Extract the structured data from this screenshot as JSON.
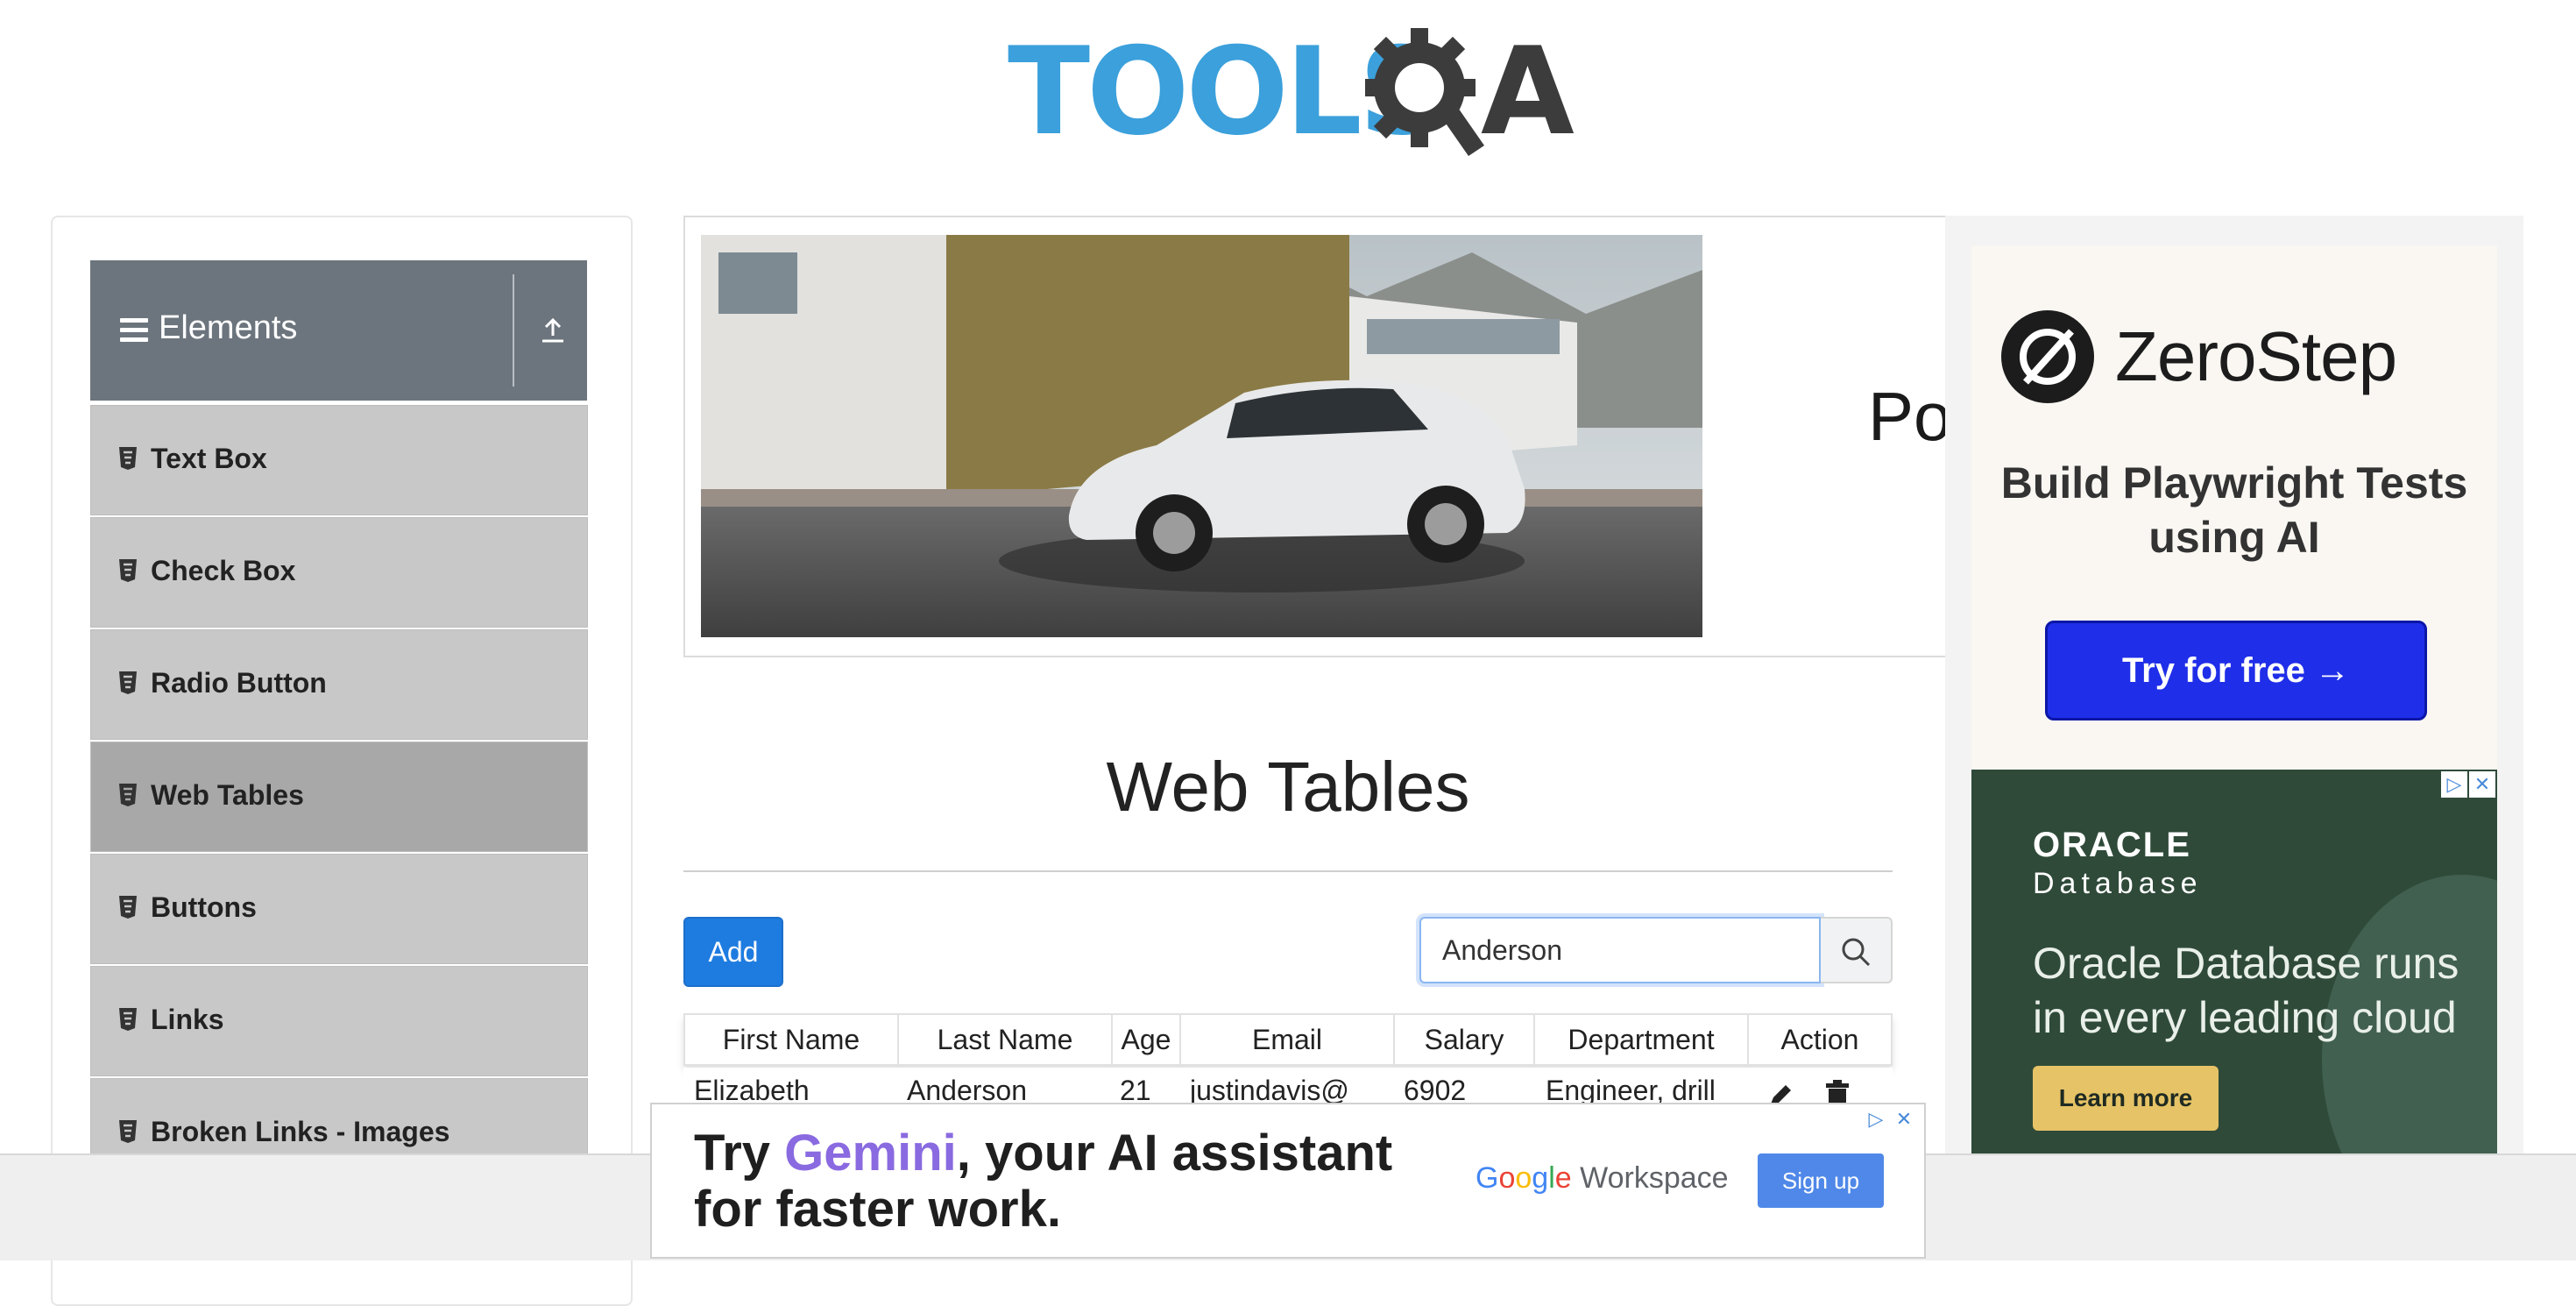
{
  "logo": {
    "text": "TOOLS",
    "suffix": "A"
  },
  "sidebar": {
    "group_title": "Elements",
    "items": [
      {
        "label": "Text Box",
        "active": false
      },
      {
        "label": "Check Box",
        "active": false
      },
      {
        "label": "Radio Button",
        "active": false
      },
      {
        "label": "Web Tables",
        "active": true
      },
      {
        "label": "Buttons",
        "active": false
      },
      {
        "label": "Links",
        "active": false
      },
      {
        "label": "Broken Links - Images",
        "active": false
      }
    ]
  },
  "banner": {
    "partial_text": "Po"
  },
  "right_ads": {
    "zerostep": {
      "name": "ZeroStep",
      "tagline": "Build Playwright Tests using AI",
      "cta": "Try for free →"
    },
    "oracle": {
      "brand": "ORACLE",
      "product": "Database",
      "copy": "Oracle Database runs in every leading cloud",
      "cta": "Learn more"
    }
  },
  "page": {
    "title": "Web Tables"
  },
  "toolbar": {
    "add_label": "Add",
    "search_value": "Anderson"
  },
  "table": {
    "headers": [
      "First Name",
      "Last Name",
      "Age",
      "Email",
      "Salary",
      "Department",
      "Action"
    ],
    "rows": [
      [
        "Elizabeth",
        "Anderson",
        "21",
        "justindavis@",
        "6902",
        "Engineer, drill",
        ""
      ]
    ]
  },
  "bottom_ad": {
    "line1_pre": "Try ",
    "line1_brand": "Gemini",
    "line1_post": ", your AI assistant",
    "line2": "for faster work.",
    "g": "G",
    "o1": "o",
    "o2": "o",
    "g2": "g",
    "l": "l",
    "e": "e",
    "workspace": " Workspace",
    "cta": "Sign up"
  },
  "ad_choice_glyphs": {
    "info": "▷",
    "close": "✕"
  },
  "colors": {
    "sidebar_header": "#6c757d",
    "accent": "#1e7ce0",
    "logo_blue": "#3ba0db"
  }
}
